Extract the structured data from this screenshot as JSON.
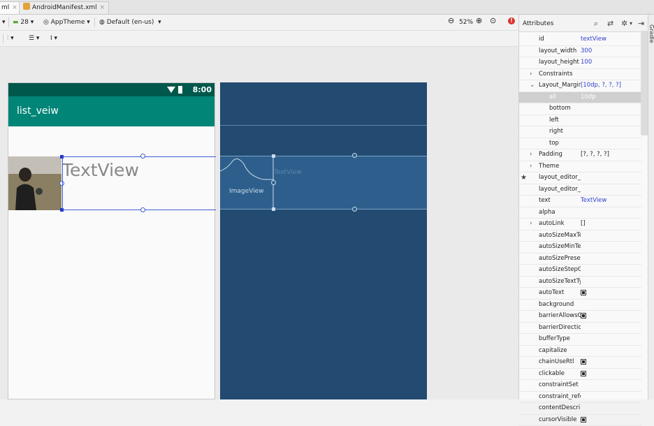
{
  "tabs": [
    {
      "label": "ml",
      "active": true
    },
    {
      "label": "AndroidManifest.xml",
      "active": false
    }
  ],
  "toolbar": {
    "api_level": "28",
    "theme": "AppTheme",
    "locale": "Default (en-us)",
    "zoom": "52%"
  },
  "device": {
    "status_time": "8:00",
    "app_title": "list_veiw",
    "textview_text": "TextView"
  },
  "blueprint": {
    "imageview_label": "ImageView",
    "textview_label": "TextView"
  },
  "attributes": {
    "panel_title": "Attributes",
    "rows": [
      {
        "name": "id",
        "value": "textView"
      },
      {
        "name": "layout_width",
        "value": "300"
      },
      {
        "name": "layout_height",
        "value": "100"
      },
      {
        "name": "Constraints",
        "value": "",
        "expand": "closed"
      },
      {
        "name": "Layout_Margin",
        "value": "[10dp, ?, ?, ?]",
        "expand": "open"
      },
      {
        "name": "all",
        "value": "10dp",
        "indent": true,
        "selected": true
      },
      {
        "name": "bottom",
        "value": "",
        "indent": true
      },
      {
        "name": "left",
        "value": "",
        "indent": true
      },
      {
        "name": "right",
        "value": "",
        "indent": true
      },
      {
        "name": "top",
        "value": "",
        "indent": true
      },
      {
        "name": "Padding",
        "value": "[?, ?, ?, ?]",
        "expand": "closed",
        "dark": true
      },
      {
        "name": "Theme",
        "value": "",
        "expand": "closed"
      },
      {
        "name": "layout_editor_a",
        "value": "",
        "star": true
      },
      {
        "name": "layout_editor_a",
        "value": ""
      },
      {
        "name": "text",
        "value": "TextView"
      },
      {
        "name": "alpha",
        "value": ""
      },
      {
        "name": "autoLink",
        "value": "[]",
        "expand": "closed",
        "dark": true
      },
      {
        "name": "autoSizeMaxTe",
        "value": ""
      },
      {
        "name": "autoSizeMinTe",
        "value": ""
      },
      {
        "name": "autoSizePreset",
        "value": ""
      },
      {
        "name": "autoSizeStepGr",
        "value": ""
      },
      {
        "name": "autoSizeTextTy",
        "value": ""
      },
      {
        "name": "autoText",
        "value": "",
        "checkbox": true
      },
      {
        "name": "background",
        "value": ""
      },
      {
        "name": "barrierAllowsG",
        "value": "",
        "checkbox": true
      },
      {
        "name": "barrierDirectior",
        "value": ""
      },
      {
        "name": "bufferType",
        "value": ""
      },
      {
        "name": "capitalize",
        "value": ""
      },
      {
        "name": "chainUseRtl",
        "value": "",
        "checkbox": true
      },
      {
        "name": "clickable",
        "value": "",
        "checkbox": true
      },
      {
        "name": "constraintSet",
        "value": ""
      },
      {
        "name": "constraint_refer",
        "value": ""
      },
      {
        "name": "contentDescrip",
        "value": ""
      },
      {
        "name": "cursorVisible",
        "value": "",
        "checkbox": true
      }
    ]
  },
  "side_tool": {
    "label": "Gradle"
  }
}
